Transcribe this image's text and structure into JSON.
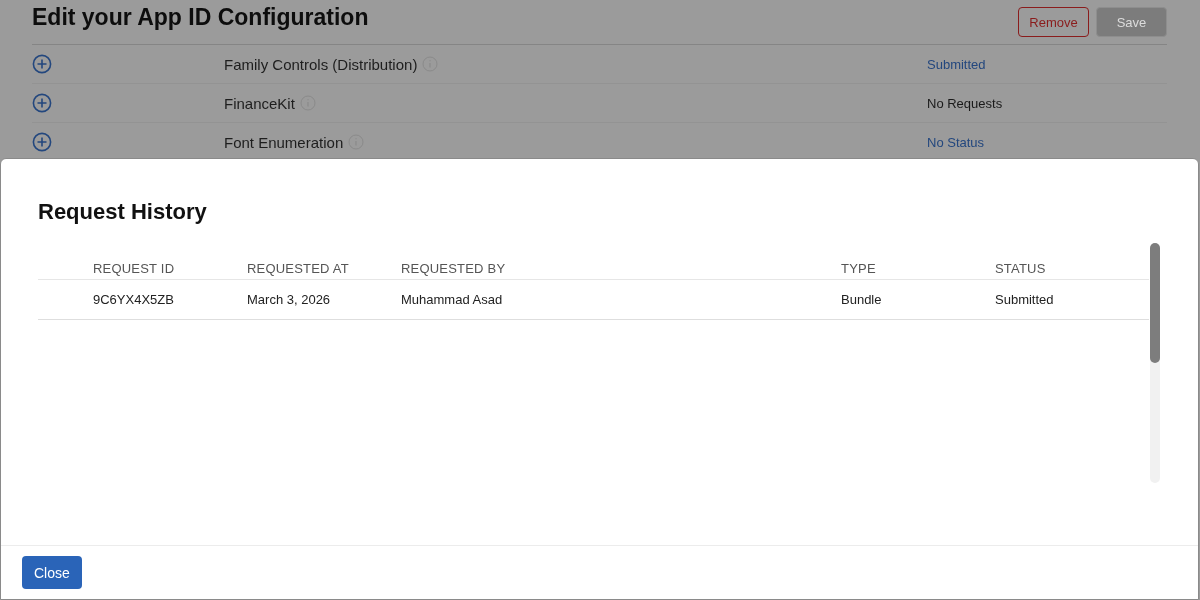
{
  "page": {
    "title": "Edit your App ID Configuration",
    "buttons": [
      {
        "label": "Remove",
        "kind": "danger",
        "disabled": false
      },
      {
        "label": "Save",
        "kind": "primary",
        "disabled": true
      }
    ],
    "capabilities": [
      {
        "name": "Family Controls (Distribution)",
        "status": "Submitted",
        "link": true
      },
      {
        "name": "FinanceKit",
        "status": "No Requests",
        "link": false
      },
      {
        "name": "Font Enumeration",
        "status": "No Status",
        "link": true
      }
    ]
  },
  "dialog": {
    "title": "Request History",
    "table": {
      "columns": [
        "REQUEST ID",
        "REQUESTED AT",
        "REQUESTED BY",
        "TYPE",
        "STATUS"
      ],
      "rows": [
        [
          "9C6YX4X5ZB",
          "March 3, 2026",
          "Muhammad Asad",
          "Bundle",
          "Submitted"
        ]
      ]
    },
    "buttons": [
      "Close"
    ]
  }
}
